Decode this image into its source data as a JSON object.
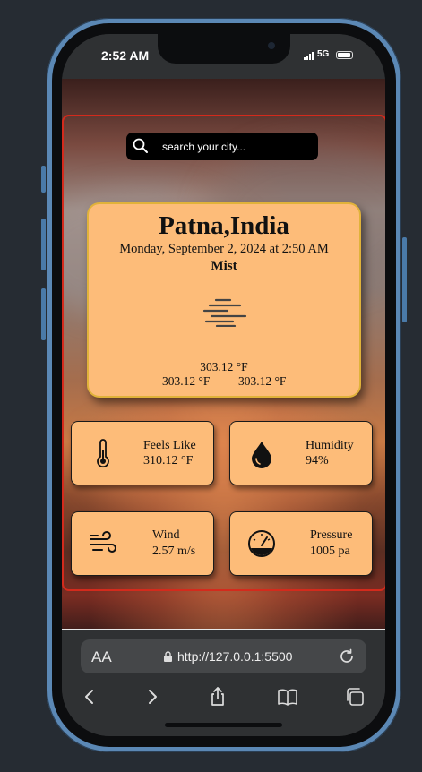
{
  "status_bar": {
    "time": "2:52 AM",
    "network": "5G"
  },
  "search": {
    "placeholder": "search your city..."
  },
  "weather": {
    "city": "Patna,India",
    "datetime": "Monday, September 2, 2024 at 2:50 AM",
    "condition": "Mist",
    "condition_icon": "mist-icon",
    "temperature": "303.12 °F",
    "temp_min": "303.12 °F",
    "temp_max": "303.12 °F"
  },
  "details": [
    {
      "label": "Feels Like",
      "value": "310.12 °F",
      "icon": "thermometer-icon"
    },
    {
      "label": "Humidity",
      "value": "94%",
      "icon": "droplet-icon"
    },
    {
      "label": "Wind",
      "value": "2.57 m/s",
      "icon": "wind-icon"
    },
    {
      "label": "Pressure",
      "value": "1005 pa",
      "icon": "gauge-icon"
    }
  ],
  "browser": {
    "text_size": "AA",
    "url": "http://127.0.0.1:5500"
  },
  "colors": {
    "card": "#fdbc79",
    "frame_border": "#d42a1c",
    "phone": "#5b88b5"
  }
}
